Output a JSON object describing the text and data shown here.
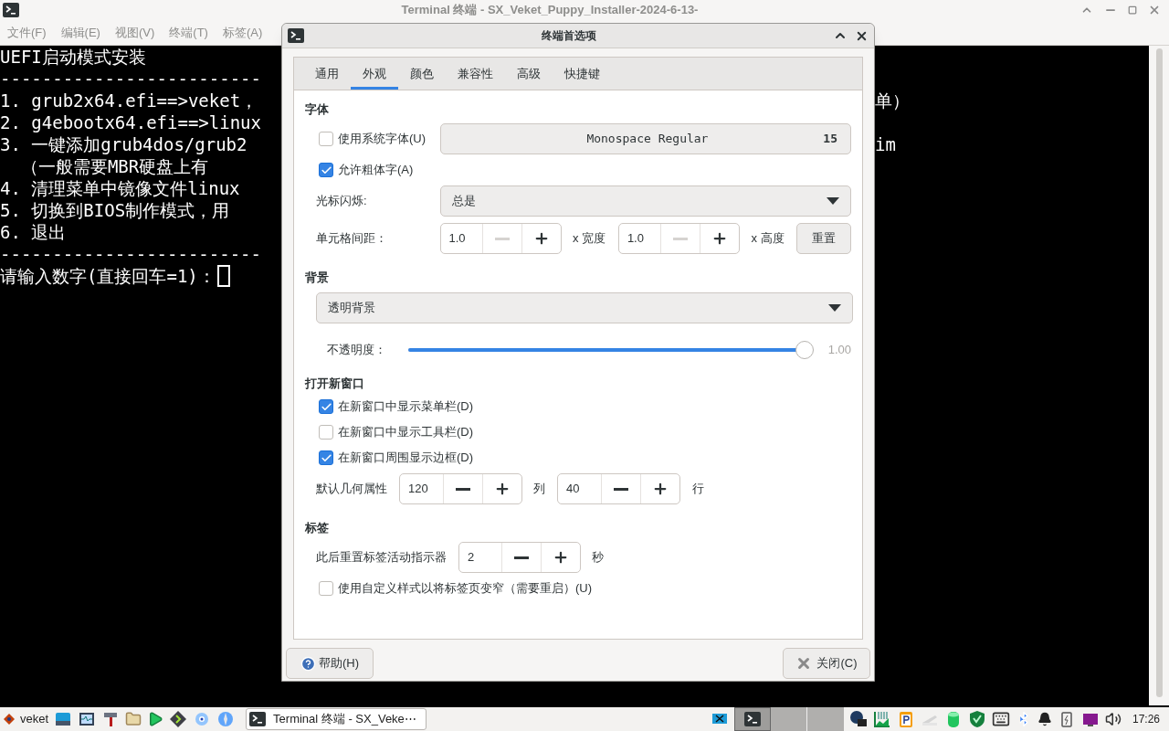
{
  "window": {
    "title": "Terminal 终端 - SX_Veket_Puppy_Installer-2024-6-13-"
  },
  "menu": [
    "文件(F)",
    "编辑(E)",
    "视图(V)",
    "终端(T)",
    "标签(A)"
  ],
  "terminal": {
    "lines": [
      {
        "left": "UEFI启动模式安装"
      },
      {
        "left": "-------------------------"
      },
      {
        "left": "1. grub2x64.efi==>veket，",
        "right": "单）"
      },
      {
        "left": "2. g4ebootx64.efi==>linux"
      },
      {
        "left": "3. 一键添加grub4dos/grub2",
        "right": "im"
      },
      {
        "left": "  （一般需要MBR硬盘上有"
      },
      {
        "left": "4. 清理菜单中镜像文件linux"
      },
      {
        "left": "5. 切换到BIOS制作模式，用"
      },
      {
        "left": "6. 退出"
      },
      {
        "left": "-------------------------"
      },
      {
        "left": "请输入数字(直接回车=1)：",
        "cursor": true
      }
    ]
  },
  "dialog": {
    "title": "终端首选项",
    "tabs": [
      {
        "label": "通用",
        "selected": false
      },
      {
        "label": "外观",
        "selected": true
      },
      {
        "label": "颜色",
        "selected": false
      },
      {
        "label": "兼容性",
        "selected": false
      },
      {
        "label": "高级",
        "selected": false
      },
      {
        "label": "快捷键",
        "selected": false
      }
    ],
    "font": {
      "heading": "字体",
      "use_system_font": {
        "label": "使用系统字体(U)",
        "checked": false
      },
      "font_button": {
        "name": "Monospace Regular",
        "size": "15"
      },
      "allow_bold": {
        "label": "允许粗体字(A)",
        "checked": true
      },
      "cursor_blink": {
        "label": "光标闪烁:",
        "value": "总是"
      },
      "cell_spacing": {
        "label": "单元格间距：",
        "width": {
          "value": "1.0",
          "decrement_disabled": true
        },
        "width_label": "x 宽度",
        "height": {
          "value": "1.0",
          "decrement_disabled": true
        },
        "height_label": "x 高度",
        "reset": "重置"
      }
    },
    "background": {
      "heading": "背景",
      "mode": "透明背景",
      "opacity": {
        "label": "不透明度：",
        "level": 1.0,
        "reading": "1.00"
      }
    },
    "new_window": {
      "heading": "打开新窗口",
      "checks": [
        {
          "label": "在新窗口中显示菜单栏(D)",
          "checked": true
        },
        {
          "label": "在新窗口中显示工具栏(D)",
          "checked": false
        },
        {
          "label": "在新窗口周围显示边框(D)",
          "checked": true
        }
      ],
      "geometry": {
        "label": "默认几何属性",
        "columns": {
          "value": "120",
          "decrement_disabled": false
        },
        "columns_unit": "列",
        "rows": {
          "value": "40",
          "decrement_disabled": false
        },
        "rows_unit": "行"
      }
    },
    "tabs_section": {
      "heading": "标签",
      "reset_label": "此后重置标签活动指示器",
      "reset_value": {
        "value": "2",
        "decrement_disabled": false
      },
      "unit": "秒",
      "narrow": {
        "label": "使用自定义样式以将标签页变窄（需要重启）(U)",
        "checked": false
      }
    },
    "help": "帮助(H)",
    "close": "关闭(C)"
  },
  "taskbar": {
    "start": "veket",
    "task": "Terminal 终端 - SX_Veke⋯",
    "clock": "17:26"
  }
}
